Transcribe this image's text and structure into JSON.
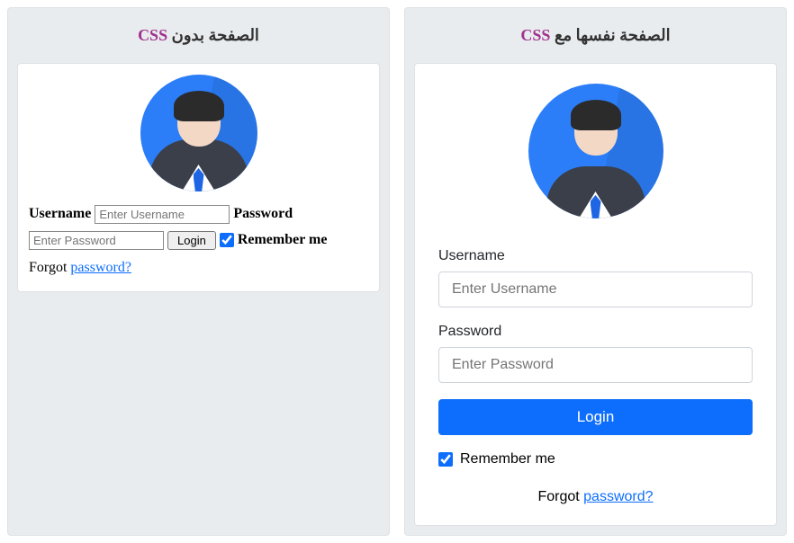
{
  "left": {
    "title_css": "CSS",
    "title_ar": "الصفحة بدون",
    "username_label": "Username",
    "username_placeholder": "Enter Username",
    "password_label": "Password",
    "password_placeholder": "Enter Password",
    "login_button": "Login",
    "remember_label": "Remember me",
    "forgot_prefix": "Forgot ",
    "forgot_link": "password?",
    "remember_checked": "true"
  },
  "right": {
    "title_css": "CSS",
    "title_ar": "الصفحة نفسها مع",
    "username_label": "Username",
    "username_placeholder": "Enter Username",
    "password_label": "Password",
    "password_placeholder": "Enter Password",
    "login_button": "Login",
    "remember_label": "Remember me",
    "forgot_prefix": "Forgot ",
    "forgot_link": "password?",
    "remember_checked": "true"
  }
}
